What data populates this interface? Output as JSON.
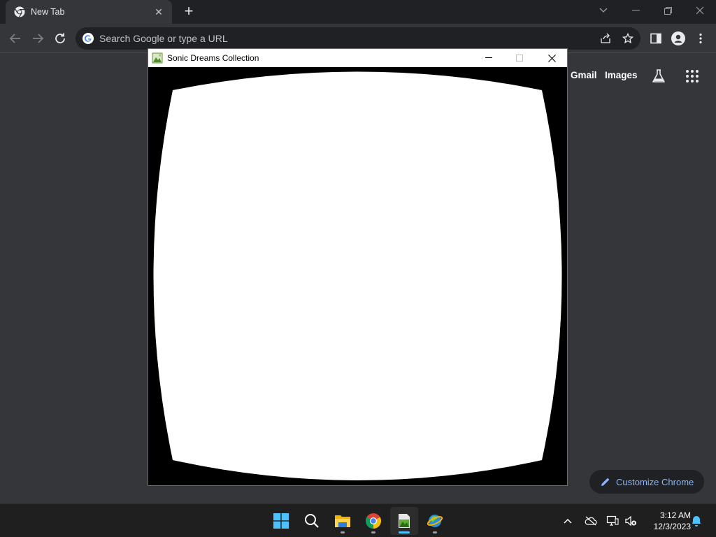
{
  "browser": {
    "tab": {
      "title": "New Tab",
      "close_label": "✕"
    },
    "new_tab_label": "+",
    "window_controls": {
      "dropdown": "⌄",
      "minimize": "—",
      "restore": "❐",
      "close": "✕"
    },
    "omnibox": {
      "placeholder": "Search Google or type a URL",
      "value": ""
    }
  },
  "ntp": {
    "gmail_label": "Gmail",
    "images_label": "Images",
    "customize_label": "Customize Chrome"
  },
  "app_window": {
    "title": "Sonic Dreams Collection",
    "controls": {
      "minimize": "—",
      "maximize": "☐",
      "close": "✕"
    },
    "canvas_background": "#000000",
    "canvas_shape_color": "#ffffff"
  },
  "taskbar": {
    "apps": [
      {
        "name": "start",
        "icon": "windows-icon"
      },
      {
        "name": "search",
        "icon": "search-icon"
      },
      {
        "name": "file-explorer",
        "icon": "folder-icon"
      },
      {
        "name": "chrome",
        "icon": "chrome-icon"
      },
      {
        "name": "sonic-dreams",
        "icon": "game-icon",
        "active": true
      },
      {
        "name": "app-6",
        "icon": "globe-icon"
      }
    ],
    "clock": {
      "time": "3:12 AM",
      "date": "12/3/2023"
    }
  },
  "colors": {
    "accent": "#8ab4f8",
    "taskbar_active": "#4cc2ff",
    "chrome_bg": "#35363a",
    "tabstrip_bg": "#202124"
  }
}
